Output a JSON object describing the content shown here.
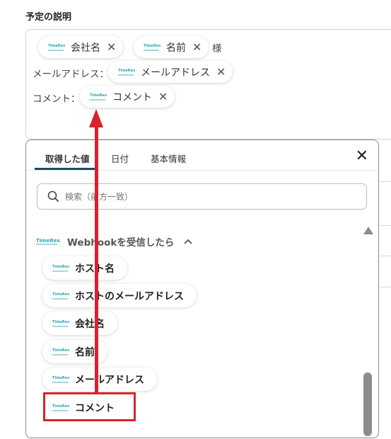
{
  "section": {
    "title": "予定の説明"
  },
  "description_chips": {
    "logo_text": "TimeRex",
    "company": "会社名",
    "name": "名前",
    "honorific": "様",
    "email_label": "メールアドレス：",
    "email": "メールアドレス",
    "comment_label": "コメント：",
    "comment": "コメント"
  },
  "popup": {
    "tabs": [
      "取得した値",
      "日付",
      "基本情報"
    ],
    "active_tab": "取得した値",
    "close_icon": "close-icon",
    "search": {
      "placeholder": "検索（前方一致）"
    },
    "group": {
      "title": "Webhookを受信したら",
      "expanded": true,
      "logo_text": "TimeRex"
    },
    "items": [
      "ホスト名",
      "ホストのメールアドレス",
      "会社名",
      "名前",
      "メールアドレス",
      "コメント"
    ],
    "highlighted_item": "コメント"
  },
  "annotation": {
    "color": "#d9232a"
  }
}
